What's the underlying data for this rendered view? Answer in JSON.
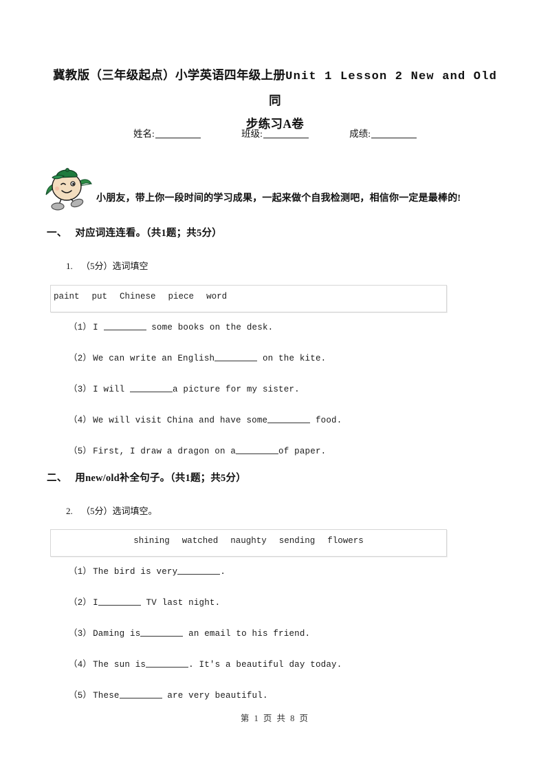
{
  "document": {
    "title_line1_cn_prefix": "冀教版（三年级起点）小学英语四年级上册",
    "title_line1_en": "Unit 1 Lesson 2 New and Old",
    "title_line1_cn_suffix": "同",
    "title_line2": "步练习A卷"
  },
  "info": {
    "name_label": "姓名:",
    "class_label": "班级:",
    "score_label": "成绩:"
  },
  "greeting": {
    "mascot_icon": "cartoon-student-mascot-icon",
    "text": "小朋友，带上你一段时间的学习成果，一起来做个自我检测吧，相信你一定是最棒的!"
  },
  "sections": [
    {
      "num": "一、",
      "title": "对应词连连看。（共1题；共5分）",
      "question": {
        "number": "1.",
        "prompt": "（5分）选词填空",
        "word_bank": [
          "paint",
          "put",
          "Chinese",
          "piece",
          "word"
        ],
        "word_bank_align": "left",
        "items": [
          {
            "label": "（1）",
            "before": "I ",
            "after": " some books on the desk."
          },
          {
            "label": "（2）",
            "before": "We can write an English",
            "after": " on the kite."
          },
          {
            "label": "（3）",
            "before": "I will ",
            "after": "a picture for my sister."
          },
          {
            "label": "（4）",
            "before": "We will visit China and have some",
            "after": " food."
          },
          {
            "label": "（5）",
            "before": "First, I draw a dragon on a",
            "after": "of paper."
          }
        ]
      }
    },
    {
      "num": "二、",
      "title": "用new/old补全句子。（共1题；共5分）",
      "question": {
        "number": "2.",
        "prompt": "（5分）选词填空。",
        "word_bank": [
          "shining",
          "watched",
          "naughty",
          "sending",
          "flowers"
        ],
        "word_bank_align": "center",
        "items": [
          {
            "label": "（1）",
            "before": "The bird is very",
            "after": "."
          },
          {
            "label": "（2）",
            "before": "I",
            "after": " TV last night."
          },
          {
            "label": "（3）",
            "before": "Daming is",
            "after": " an email to his friend."
          },
          {
            "label": "（4）",
            "before": "The sun is",
            "after": ". It's a beautiful day today."
          },
          {
            "label": "（5）",
            "before": "These",
            "after": " are very beautiful."
          }
        ]
      }
    }
  ],
  "footer": {
    "text": "第 1 页 共 8 页"
  },
  "colors": {
    "text": "#1a1a1a",
    "box_border": "#d6d6d6",
    "mascot_cap": "#1f7a3d",
    "mascot_body": "#f2dcc0"
  }
}
